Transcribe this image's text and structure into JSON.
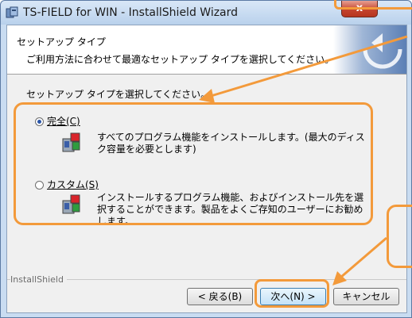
{
  "window": {
    "title": "TS-FIELD for WIN - InstallShield Wizard",
    "close_label": "x"
  },
  "header": {
    "title": "セットアップ タイプ",
    "subtitle": "ご利用方法に合わせて最適なセットアップ タイプを選択してください。"
  },
  "main": {
    "prompt": "セットアップ タイプを選択してください。",
    "options": [
      {
        "label": "完全(C)",
        "selected": true,
        "description": "すべてのプログラム機能をインストールします。(最大のディスク容量を必要とします)"
      },
      {
        "label": "カスタム(S)",
        "selected": false,
        "description": "インストールするプログラム機能、およびインストール先を選択することができます。製品をよくご存知のユーザーにお勧めします。"
      }
    ]
  },
  "footer": {
    "group_label": "InstallShield",
    "back_label": "< 戻る(B)",
    "next_label": "次へ(N) >",
    "cancel_label": "キャンセル"
  },
  "colors": {
    "annotation": "#f39a3b",
    "selected_radio": "#2a55a8"
  },
  "icons": {
    "window": "installshield-icon",
    "option": "package-icon"
  }
}
